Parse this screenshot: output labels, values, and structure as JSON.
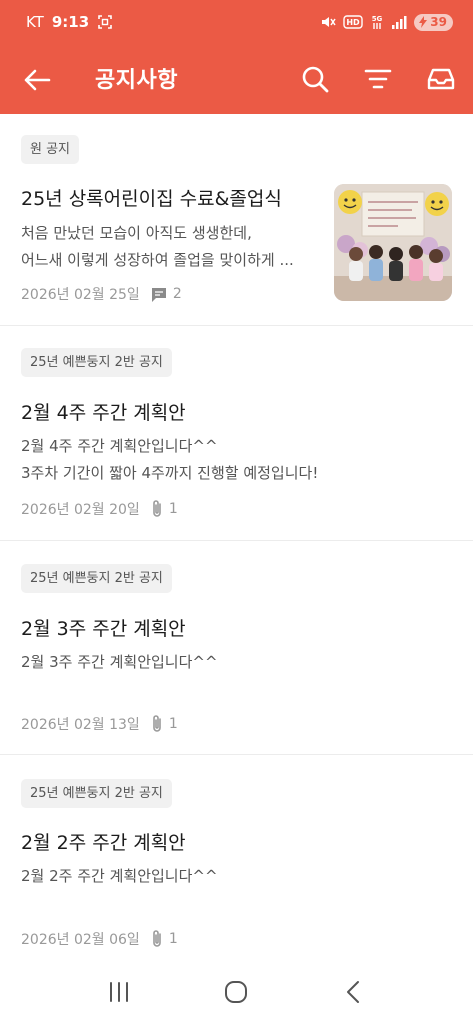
{
  "status_bar": {
    "carrier": "KT",
    "time": "9:13",
    "battery": "39",
    "icons": [
      "screenshot-icon",
      "mute-icon",
      "hd-icon",
      "5g-icon",
      "signal-icon",
      "battery-icon"
    ]
  },
  "app_bar": {
    "title": "공지사항",
    "icons": [
      "back-arrow-icon",
      "search-icon",
      "filter-icon",
      "inbox-icon"
    ]
  },
  "notices": [
    {
      "badge": "원 공지",
      "title": "25년 상록어린이집 수료&졸업식",
      "body_line1": "처음 만났던 모습이 아직도 생생한데,",
      "body_line2": "어느새 이렇게 성장하여 졸업을 맞이하게 ...",
      "date": "2026년 02월 25일",
      "count_type": "comment",
      "count": "2",
      "has_thumbnail": true
    },
    {
      "badge": "25년 예쁜둥지 2반 공지",
      "title": "2월 4주 주간 계획안",
      "body_line1": "2월 4주 주간 계획안입니다^^",
      "body_line2": "3주차 기간이 짧아 4주까지 진행할 예정입니다!",
      "date": "2026년 02월 20일",
      "count_type": "attachment",
      "count": "1",
      "has_thumbnail": false
    },
    {
      "badge": "25년 예쁜둥지 2반 공지",
      "title": "2월 3주 주간 계획안",
      "body_line1": "2월 3주 주간 계획안입니다^^",
      "body_line2": "",
      "date": "2026년 02월 13일",
      "count_type": "attachment",
      "count": "1",
      "has_thumbnail": false
    },
    {
      "badge": "25년 예쁜둥지 2반 공지",
      "title": "2월 2주 주간 계획안",
      "body_line1": "2월 2주 주간 계획안입니다^^",
      "body_line2": "",
      "date": "2026년 02월 06일",
      "count_type": "attachment",
      "count": "1",
      "has_thumbnail": false
    }
  ],
  "nav_bar": {
    "icons": [
      "recent-apps-icon",
      "home-icon",
      "back-icon"
    ]
  },
  "colors": {
    "accent": "#eb5a45",
    "badge_bg": "#f1f1f1",
    "meta_text": "#999999"
  }
}
